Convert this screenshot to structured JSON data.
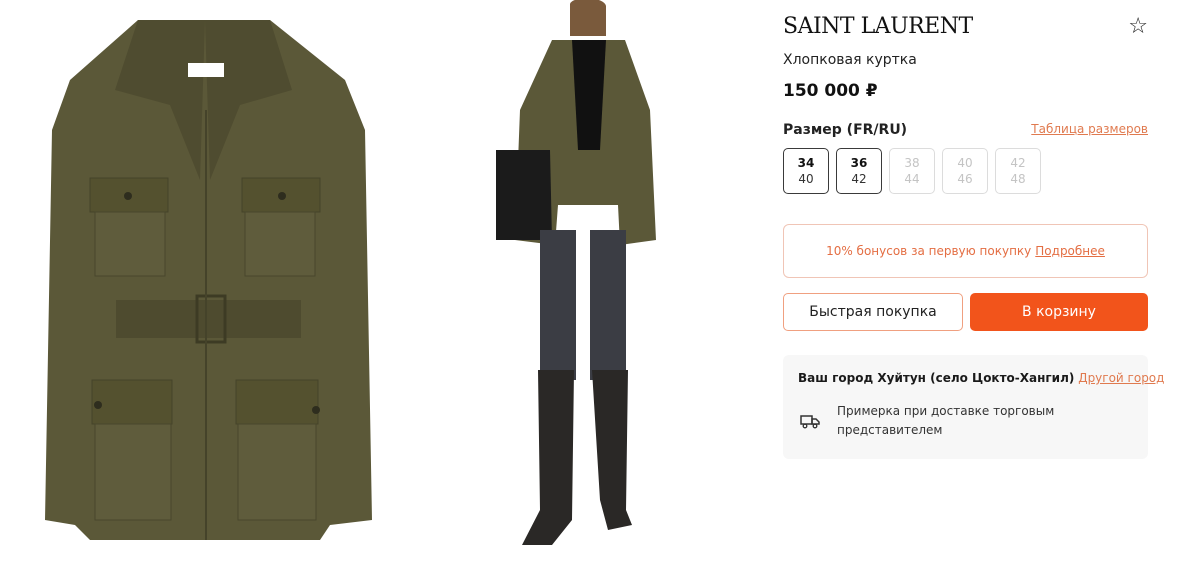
{
  "product": {
    "brand": "SAINT LAURENT",
    "name": "Хлопковая куртка",
    "price": "150 000 ₽"
  },
  "sizes": {
    "label": "Размер (FR/RU)",
    "table_link": "Таблица размеров",
    "options": [
      {
        "fr": "34",
        "ru": "40",
        "available": true
      },
      {
        "fr": "36",
        "ru": "42",
        "available": true
      },
      {
        "fr": "38",
        "ru": "44",
        "available": false
      },
      {
        "fr": "40",
        "ru": "46",
        "available": false
      },
      {
        "fr": "42",
        "ru": "48",
        "available": false
      }
    ]
  },
  "bonus": {
    "text": "10% бонусов за первую покупку",
    "link": "Подробнее"
  },
  "actions": {
    "quick_buy": "Быстрая покупка",
    "add_to_cart": "В корзину"
  },
  "delivery": {
    "city_text": "Ваш город Хуйтун (село Цокто-Хангил)",
    "other_city": "Другой город",
    "fitting_text": "Примерка при доставке торговым представителем"
  },
  "colors": {
    "accent": "#f2541b",
    "link": "#e07a4f",
    "jacket": "#5b5838"
  },
  "icons": {
    "favorite": "star-outline-icon",
    "delivery": "truck-icon"
  }
}
